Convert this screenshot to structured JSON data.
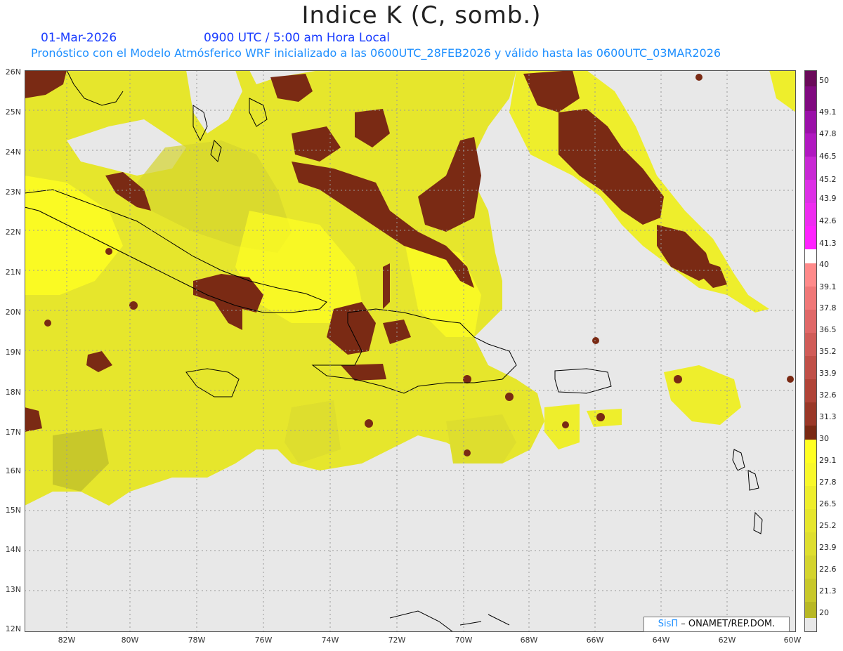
{
  "header": {
    "title": "Indice K (C, somb.)",
    "date": "01-Mar-2026",
    "time": "0900 UTC / 5:00 am Hora Local",
    "subtitle": "Pronóstico con el Modelo Atmósferico WRF inicializado a las 0600UTC_28FEB2026 y válido hasta las  0600UTC_03MAR2026"
  },
  "axes": {
    "lat_labels": [
      "26N",
      "25N",
      "24N",
      "23N",
      "22N",
      "21N",
      "20N",
      "19N",
      "18N",
      "17N",
      "16N",
      "15N",
      "14N",
      "13N",
      "12N"
    ],
    "lon_labels": [
      "82W",
      "80W",
      "78W",
      "76W",
      "74W",
      "72W",
      "70W",
      "68W",
      "66W",
      "64W",
      "62W",
      "60W"
    ]
  },
  "colorbar": {
    "labels": [
      "50",
      "49.1",
      "47.8",
      "46.5",
      "45.2",
      "43.9",
      "42.6",
      "41.3",
      "40",
      "39.1",
      "37.8",
      "36.5",
      "35.2",
      "33.9",
      "32.6",
      "31.3",
      "30",
      "29.1",
      "27.8",
      "26.5",
      "25.2",
      "23.9",
      "22.6",
      "21.3",
      "20"
    ],
    "colors": {
      "c50": "#6a0a5a",
      "c49": "#800a80",
      "c47": "#9a10a8",
      "c46": "#b018c0",
      "c45": "#c828d4",
      "c43": "#dd30e6",
      "c42": "#ee2cf0",
      "c41": "#ff22ff",
      "c39": "#ff8a8a",
      "c37": "#f07878",
      "c36": "#e06868",
      "c35": "#d05c58",
      "c33": "#c05048",
      "c32": "#b04438",
      "c31": "#9a3828",
      "c30": "#7a2a14",
      "y29": "#ffff22",
      "y27": "#f8f82a",
      "y26": "#eeee2c",
      "y25": "#e6e62c",
      "y23": "#dede2e",
      "y22": "#d4d42e",
      "y21": "#c8c82a",
      "y20": "#b8b824",
      "none": "#e8e8e8"
    }
  },
  "credit": {
    "logo": "SisΠ",
    "text": "– ONAMET/REP.DOM."
  }
}
